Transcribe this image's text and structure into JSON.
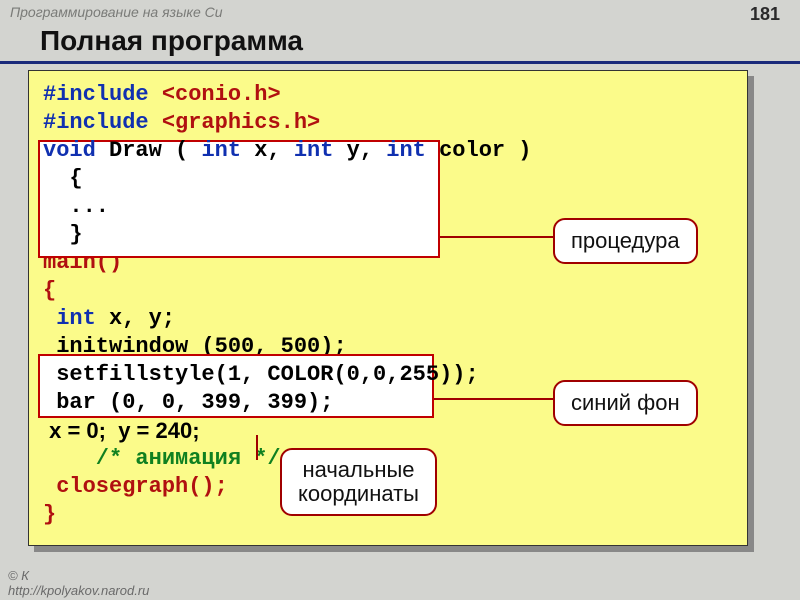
{
  "header": {
    "course": "Программирование на языке Си",
    "page": "181"
  },
  "title": "Полная программа",
  "code": {
    "l1a": "#include",
    "l1b": " <conio.h>",
    "l2a": "#include",
    "l2b": " <graphics.h>",
    "l3a": "void",
    "l3b": " Draw ( ",
    "l3c": "int",
    "l3d": " x, ",
    "l3e": "int",
    "l3f": " y, ",
    "l3g": "int",
    "l3h": " color )",
    "l4": "  {",
    "l5": "  ...",
    "l6": "  }",
    "l7": "main()",
    "l8": "{",
    "l9a": " int",
    "l9b": " x, y;",
    "l10": " initwindow (500, 500);",
    "l11": " setfillstyle(1, COLOR(0,0,255));",
    "l12": " bar (0, 0, 399, 399);",
    "l13a": " x = 0;  y = 240;",
    "l14a": "    /* анимация */",
    "l15": " closegraph();",
    "l16": "}"
  },
  "callouts": {
    "c1": "процедура",
    "c2": "синий фон",
    "c3l1": "начальные",
    "c3l2": "координаты"
  },
  "footer": {
    "l1": "© К",
    "l2": "http://kpolyakov.narod.ru"
  }
}
